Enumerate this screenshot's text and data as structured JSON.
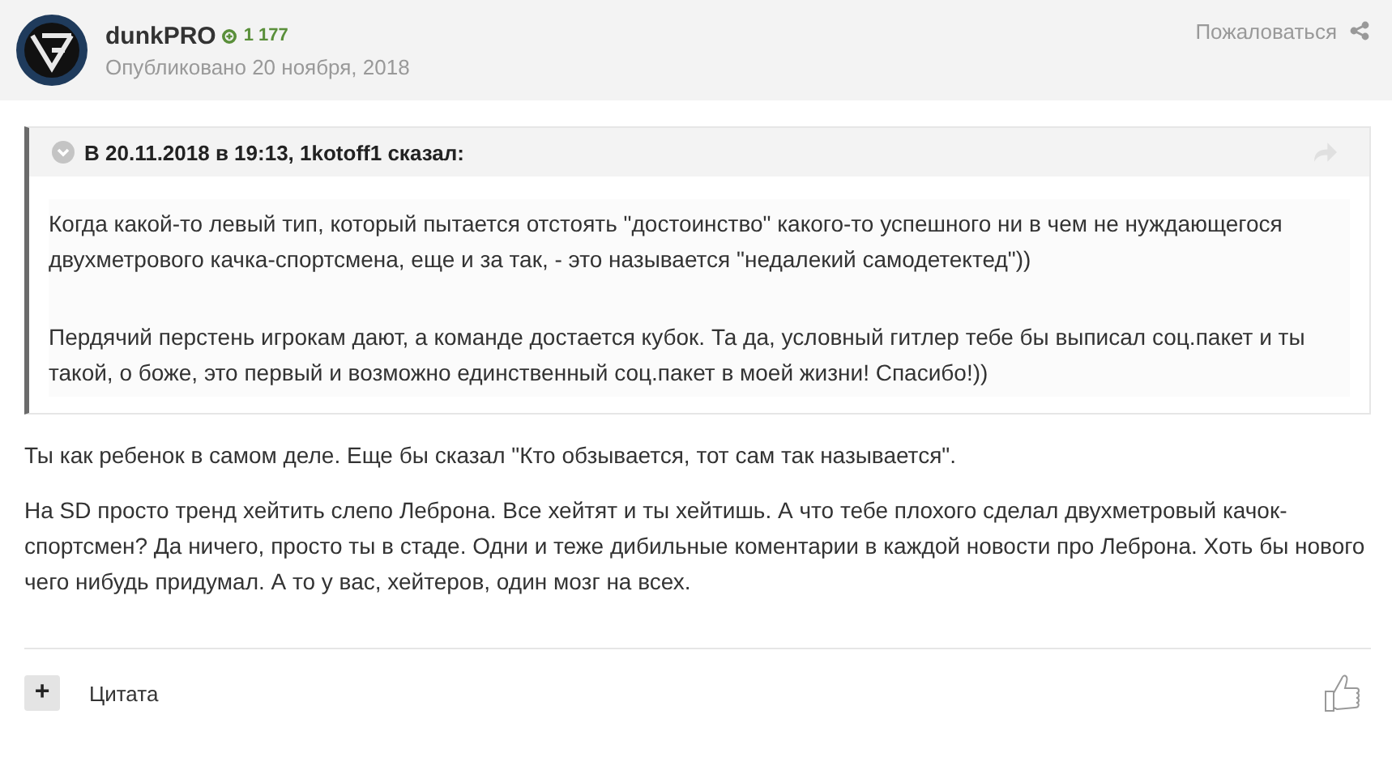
{
  "author": {
    "name": "dunkPRO",
    "reputation": "1 177",
    "posted": "Опубликовано 20 ноября, 2018"
  },
  "report_link": "Пожаловаться",
  "quote": {
    "expanded": false,
    "header": "В 20.11.2018 в 19:13, 1kotoff1 сказал:",
    "paragraphs": [
      "Когда какой-то левый тип, который пытается отстоять \"достоинство\" какого-то успешного ни в чем не нуждающегося двухметрового качка-спортсмена, еще и за так, - это называется \"недалекий самодетектед\"))",
      "Пердячий перстень игрокам дают, а команде достается кубок. Та да, условный гитлер тебе бы выписал соц.пакет и ты такой, о боже, это первый и возможно единственный соц.пакет в моей жизни! Спасибо!))"
    ]
  },
  "paragraphs": [
    "Ты как ребенок в самом деле. Еще бы сказал \"Кто обзывается, тот сам так называется\".",
    "На SD просто тренд хейтить слепо Леброна. Все хейтят и ты хейтишь. А что тебе плохого сделал двухметровый качок-спортсмен? Да ничего, просто ты в стаде. Одни и теже дибильные коментарии в каждой новости про Леброна. Хоть бы нового чего нибудь придумал. А то у вас, хейтеров, один мозг на всех."
  ],
  "footer": {
    "multiquote_symbol": "+",
    "quote_button": "Цитата"
  }
}
